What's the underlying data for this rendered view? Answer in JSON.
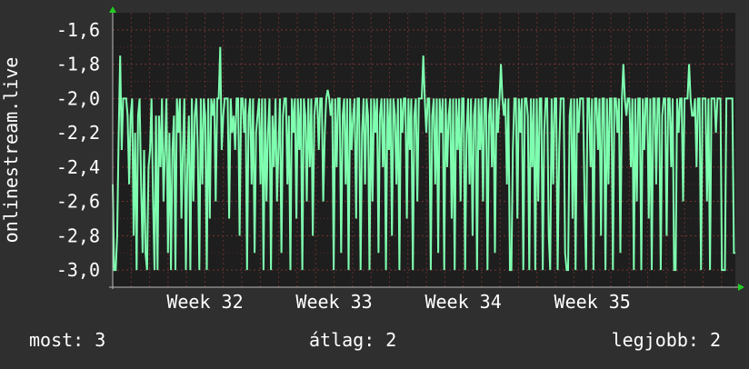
{
  "chart_data": {
    "type": "line",
    "ylabel": "onlinestream.live",
    "ylim": [
      -3.1,
      -1.5
    ],
    "yticks": [
      -1.6,
      -1.8,
      -2.0,
      -2.2,
      -2.4,
      -2.6,
      -2.8,
      -3.0
    ],
    "ytick_labels": [
      "-1,6",
      "-1,8",
      "-2,0",
      "-2,2",
      "-2,4",
      "-2,6",
      "-2,8",
      "-3,0"
    ],
    "xlim": [
      0,
      540
    ],
    "xticks": [
      80,
      192,
      304,
      416
    ],
    "xtick_labels": [
      "Week 32",
      "Week 33",
      "Week 34",
      "Week 35"
    ],
    "grid": true,
    "series": [
      {
        "color": "#7fffb0",
        "values": [
          -2.5,
          -3.0,
          -3.0,
          -2.8,
          -2.2,
          -1.75,
          -2.3,
          -2.0,
          -2.0,
          -2.0,
          -2.1,
          -2.5,
          -2.1,
          -2.0,
          -2.8,
          -2.2,
          -3.0,
          -2.1,
          -2.0,
          -2.5,
          -2.9,
          -2.3,
          -2.9,
          -3.0,
          -2.4,
          -2.3,
          -2.0,
          -2.6,
          -3.0,
          -2.1,
          -3.0,
          -2.1,
          -2.4,
          -2.0,
          -2.6,
          -2.3,
          -2.0,
          -2.9,
          -2.2,
          -3.0,
          -2.3,
          -2.1,
          -3.0,
          -2.0,
          -2.2,
          -2.0,
          -2.7,
          -2.3,
          -2.0,
          -3.0,
          -2.4,
          -2.1,
          -3.0,
          -2.0,
          -2.6,
          -2.1,
          -2.0,
          -2.3,
          -3.0,
          -2.0,
          -2.5,
          -2.0,
          -2.1,
          -3.0,
          -2.0,
          -2.7,
          -2.0,
          -2.1,
          -2.0,
          -2.6,
          -2.0,
          -2.0,
          -1.7,
          -2.3,
          -2.1,
          -2.0,
          -2.0,
          -2.0,
          -2.7,
          -2.0,
          -2.2,
          -2.1,
          -2.3,
          -2.0,
          -2.0,
          -2.8,
          -2.0,
          -2.0,
          -2.2,
          -2.0,
          -3.0,
          -2.1,
          -2.0,
          -2.5,
          -2.0,
          -2.9,
          -2.2,
          -2.1,
          -2.0,
          -2.5,
          -2.0,
          -3.0,
          -2.0,
          -2.6,
          -2.2,
          -2.0,
          -3.0,
          -2.1,
          -2.4,
          -2.0,
          -2.6,
          -2.3,
          -2.0,
          -2.9,
          -2.1,
          -2.0,
          -2.0,
          -2.5,
          -2.1,
          -3.0,
          -2.0,
          -2.2,
          -2.0,
          -2.7,
          -2.0,
          -2.3,
          -2.0,
          -3.0,
          -2.0,
          -2.1,
          -2.6,
          -2.0,
          -2.4,
          -2.0,
          -2.8,
          -2.1,
          -2.0,
          -2.0,
          -2.3,
          -2.0,
          -2.0,
          -2.6,
          -2.2,
          -2.0,
          -1.95,
          -2.0,
          -2.1,
          -2.0,
          -3.0,
          -2.0,
          -2.4,
          -2.0,
          -2.0,
          -2.9,
          -2.1,
          -2.0,
          -2.5,
          -2.0,
          -3.0,
          -2.0,
          -2.3,
          -2.1,
          -2.0,
          -2.7,
          -2.0,
          -2.0,
          -3.0,
          -2.2,
          -2.0,
          -2.5,
          -2.0,
          -2.1,
          -3.0,
          -2.0,
          -2.6,
          -2.0,
          -2.2,
          -2.0,
          -2.9,
          -2.1,
          -2.0,
          -2.4,
          -2.0,
          -3.0,
          -2.0,
          -2.3,
          -2.0,
          -2.8,
          -2.0,
          -2.1,
          -2.5,
          -2.0,
          -3.0,
          -2.0,
          -2.2,
          -2.0,
          -2.0,
          -2.7,
          -2.0,
          -2.3,
          -2.0,
          -3.0,
          -2.1,
          -2.0,
          -2.6,
          -2.0,
          -2.0,
          -2.0,
          -1.75,
          -2.0,
          -2.2,
          -2.0,
          -2.0,
          -3.0,
          -2.1,
          -2.0,
          -2.5,
          -2.0,
          -2.9,
          -2.0,
          -2.2,
          -2.0,
          -3.0,
          -2.0,
          -2.4,
          -2.1,
          -2.0,
          -2.7,
          -2.0,
          -3.0,
          -2.0,
          -2.3,
          -2.0,
          -2.6,
          -2.0,
          -2.0,
          -3.0,
          -2.2,
          -2.0,
          -2.5,
          -2.0,
          -2.8,
          -2.1,
          -2.0,
          -3.0,
          -2.0,
          -2.3,
          -2.0,
          -2.6,
          -2.0,
          -2.0,
          -3.0,
          -2.1,
          -2.0,
          -2.4,
          -2.0,
          -2.9,
          -2.0,
          -2.2,
          -2.0,
          -1.8,
          -2.0,
          -2.1,
          -2.0,
          -2.5,
          -2.0,
          -3.0,
          -3.0,
          -2.3,
          -2.0,
          -2.0,
          -2.7,
          -2.0,
          -2.2,
          -2.0,
          -3.0,
          -2.0,
          -2.0,
          -2.1,
          -3.0,
          -2.0,
          -2.4,
          -2.0,
          -3.0,
          -2.0,
          -2.6,
          -2.0,
          -2.0,
          -3.0,
          -2.2,
          -2.0,
          -2.0,
          -2.8,
          -3.0,
          -2.0,
          -2.5,
          -2.0,
          -2.0,
          -3.0,
          -2.3,
          -2.0,
          -2.0,
          -2.0,
          -2.9,
          -3.0,
          -3.0,
          -2.1,
          -2.0,
          -2.7,
          -2.0,
          -3.0,
          -2.0,
          -2.2,
          -2.0,
          -2.0,
          -2.0,
          -2.6,
          -3.0,
          -2.0,
          -2.0,
          -2.4,
          -2.0,
          -3.0,
          -2.0,
          -2.0,
          -2.3,
          -2.0,
          -2.8,
          -2.0,
          -2.0,
          -3.0,
          -2.0,
          -2.5,
          -2.0,
          -2.0,
          -3.0,
          -2.0,
          -2.0,
          -2.2,
          -2.0,
          -2.9,
          -2.0,
          -1.8,
          -2.0,
          -2.1,
          -2.0,
          -2.0,
          -2.4,
          -2.0,
          -3.0,
          -2.0,
          -2.6,
          -2.0,
          -2.0,
          -3.0,
          -2.0,
          -2.3,
          -2.0,
          -2.0,
          -2.7,
          -2.0,
          -3.0,
          -2.0,
          -2.0,
          -2.5,
          -2.0,
          -2.0,
          -3.0,
          -2.1,
          -2.0,
          -2.0,
          -2.8,
          -2.0,
          -2.0,
          -2.4,
          -2.0,
          -3.0,
          -3.0,
          -2.0,
          -2.2,
          -2.0,
          -2.0,
          -2.6,
          -2.0,
          -2.0,
          -2.0,
          -1.8,
          -2.0,
          -2.1,
          -2.1,
          -2.0,
          -2.4,
          -2.0,
          -2.0,
          -3.0,
          -2.0,
          -2.0,
          -2.0,
          -2.6,
          -2.0,
          -3.0,
          -2.0,
          -2.0,
          -2.0,
          -2.2,
          -2.0,
          -2.0,
          -2.0,
          -3.0,
          -3.0,
          -3.0,
          -2.0,
          -2.0,
          -2.0,
          -2.0,
          -2.0,
          -2.9,
          -2.9
        ]
      }
    ]
  },
  "stats": {
    "now": "most: 3",
    "avg": "átlag: 2",
    "best": "legjobb: 2"
  }
}
